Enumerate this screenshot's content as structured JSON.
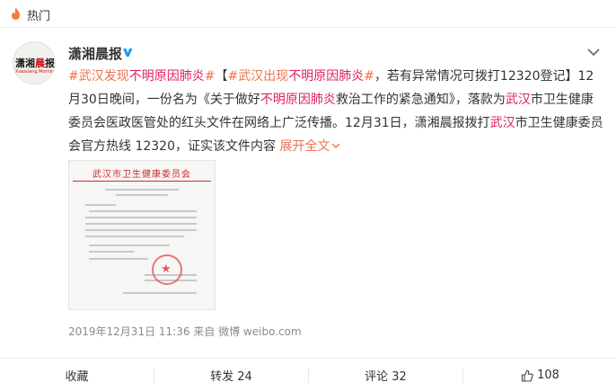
{
  "topbar": {
    "title": "热门"
  },
  "user": {
    "name": "潇湘晨报",
    "avatar_line1_a": "潇湘",
    "avatar_line1_b": "晨",
    "avatar_line1_c": "报",
    "avatar_line2": "Xiaoxiang Morning Post",
    "verified_icon": "verified-v-icon"
  },
  "post": {
    "tag1_prefix": "#武汉",
    "tag1_mid": "发现",
    "tag1_hl": "不明原因肺炎",
    "tag1_suffix": "#",
    "bracket_open": "【",
    "tag2_prefix": "#武汉出现",
    "tag2_hl": "不明原因肺炎",
    "tag2_suffix": "#",
    "t1": "，若有异常情况可拨打12320登记】12月30日晚间，一份名为《关于做好",
    "hl1": "不明原因肺炎",
    "t2": "救治工作的紧急通知》，落款为",
    "hl2": "武汉",
    "t3": "市卫生健康委员会医政医管处的红头文件在网络上广泛传播。12月31日，潇湘晨报拨打",
    "hl3": "武汉",
    "t4": "市卫生健康委员会官方热线 12320，证实该文件内容",
    "expand": "展开全文",
    "expand_icon": "chevron-down-icon"
  },
  "document_image": {
    "header": "武汉市卫生健康委员会"
  },
  "meta": {
    "text": "2019年12月31日 11:36  来自 微博 weibo.com"
  },
  "actions": {
    "favorite": "收藏",
    "repost": "转发 24",
    "comment": "评论 32",
    "like_count": "108"
  },
  "colors": {
    "tag": "#eb7350",
    "highlight": "#e0205e",
    "text": "#333333",
    "meta": "#8b8b8b"
  }
}
